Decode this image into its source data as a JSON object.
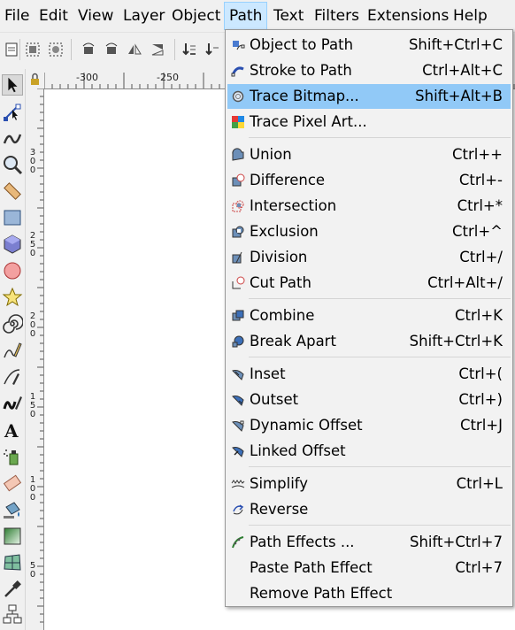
{
  "menubar": [
    "File",
    "Edit",
    "View",
    "Layer",
    "Object",
    "Path",
    "Text",
    "Filters",
    "Extensions",
    "Help"
  ],
  "hruler_labels": [
    "-300",
    "-250"
  ],
  "vruler_labels": [
    "300",
    "250",
    "200",
    "150",
    "100",
    "50"
  ],
  "menu": {
    "groups": [
      [
        {
          "label": "Object to Path",
          "shortcut": "Shift+Ctrl+C",
          "icon": "object-to-path-icon"
        },
        {
          "label": "Stroke to Path",
          "shortcut": "Ctrl+Alt+C",
          "icon": "stroke-to-path-icon"
        },
        {
          "label": "Trace Bitmap...",
          "shortcut": "Shift+Alt+B",
          "icon": "trace-bitmap-icon",
          "highlighted": true
        },
        {
          "label": "Trace Pixel Art...",
          "shortcut": "",
          "icon": "trace-pixel-art-icon"
        }
      ],
      [
        {
          "label": "Union",
          "shortcut": "Ctrl++",
          "icon": "union-icon"
        },
        {
          "label": "Difference",
          "shortcut": "Ctrl+-",
          "icon": "difference-icon"
        },
        {
          "label": "Intersection",
          "shortcut": "Ctrl+*",
          "icon": "intersection-icon"
        },
        {
          "label": "Exclusion",
          "shortcut": "Ctrl+^",
          "icon": "exclusion-icon"
        },
        {
          "label": "Division",
          "shortcut": "Ctrl+/",
          "icon": "division-icon"
        },
        {
          "label": "Cut Path",
          "shortcut": "Ctrl+Alt+/",
          "icon": "cut-path-icon"
        }
      ],
      [
        {
          "label": "Combine",
          "shortcut": "Ctrl+K",
          "icon": "combine-icon"
        },
        {
          "label": "Break Apart",
          "shortcut": "Shift+Ctrl+K",
          "icon": "break-apart-icon"
        }
      ],
      [
        {
          "label": "Inset",
          "shortcut": "Ctrl+(",
          "icon": "inset-icon"
        },
        {
          "label": "Outset",
          "shortcut": "Ctrl+)",
          "icon": "outset-icon"
        },
        {
          "label": "Dynamic Offset",
          "shortcut": "Ctrl+J",
          "icon": "dynamic-offset-icon"
        },
        {
          "label": "Linked Offset",
          "shortcut": "",
          "icon": "linked-offset-icon"
        }
      ],
      [
        {
          "label": "Simplify",
          "shortcut": "Ctrl+L",
          "icon": "simplify-icon"
        },
        {
          "label": "Reverse",
          "shortcut": "",
          "icon": "reverse-icon"
        }
      ],
      [
        {
          "label": "Path Effects ...",
          "shortcut": "Shift+Ctrl+7",
          "icon": "path-effects-icon"
        },
        {
          "label": "Paste Path Effect",
          "shortcut": "Ctrl+7",
          "icon": ""
        },
        {
          "label": "Remove Path Effect",
          "shortcut": "",
          "icon": ""
        }
      ]
    ]
  },
  "colors": {
    "highlight": "#91c9f7",
    "menu_bg": "#f2f2f2",
    "active_menubar": "#cce8ff"
  }
}
